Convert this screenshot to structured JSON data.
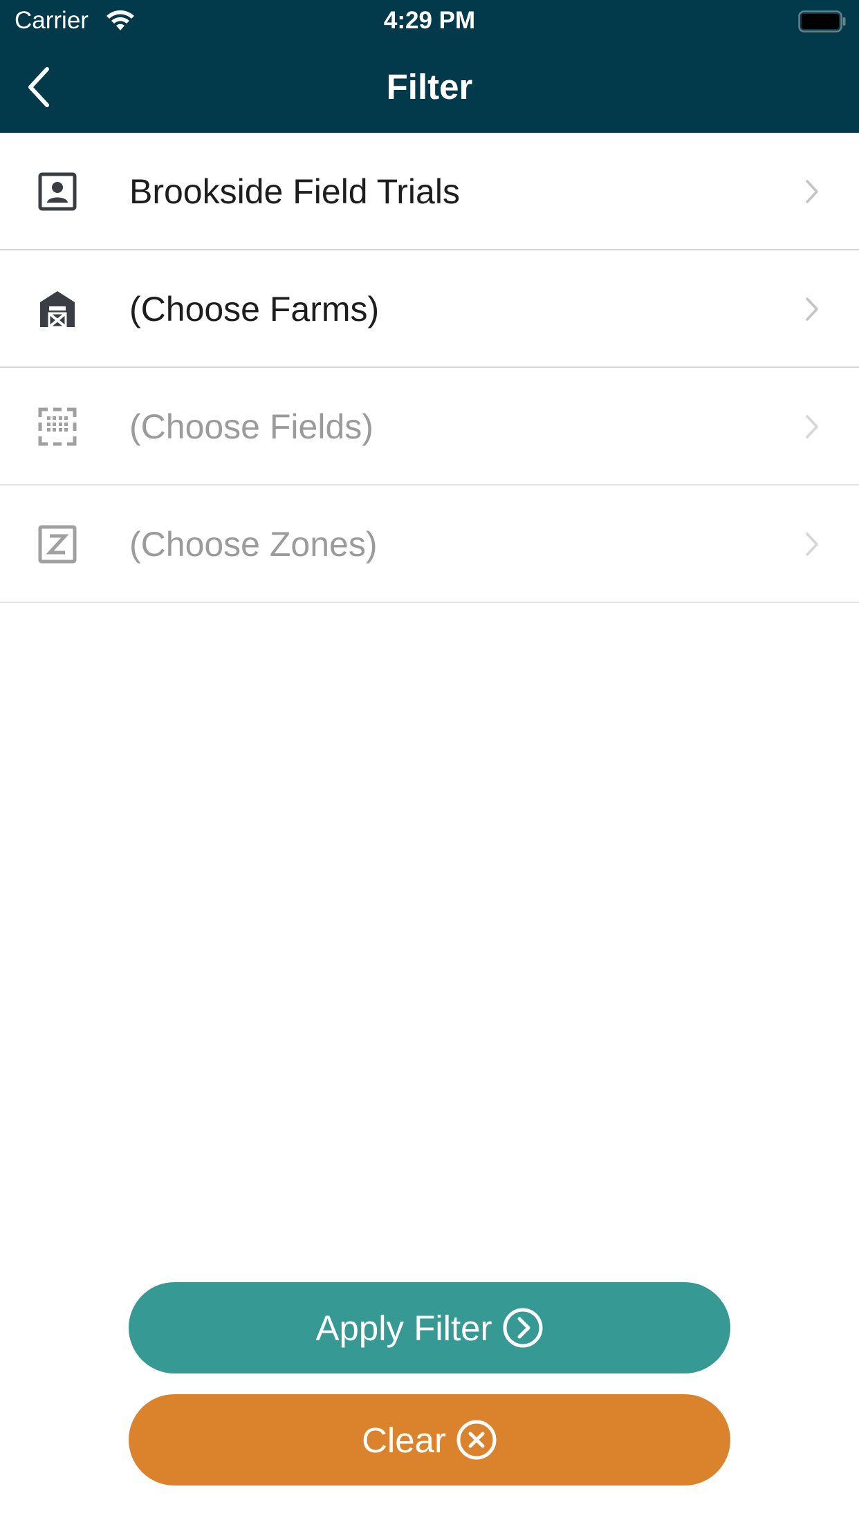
{
  "status_bar": {
    "carrier": "Carrier",
    "time": "4:29 PM",
    "icons": [
      "wifi-icon",
      "battery-icon"
    ]
  },
  "nav": {
    "title": "Filter",
    "back_icon": "chevron-left-icon"
  },
  "rows": [
    {
      "label": "Brookside Field Trials",
      "icon": "contact-card-icon",
      "enabled": true
    },
    {
      "label": "(Choose Farms)",
      "icon": "barn-icon",
      "enabled": true
    },
    {
      "label": "(Choose Fields)",
      "icon": "field-grid-icon",
      "enabled": false
    },
    {
      "label": "(Choose Zones)",
      "icon": "zone-z-icon",
      "enabled": false
    }
  ],
  "buttons": {
    "apply_label": "Apply Filter",
    "apply_icon": "arrow-circle-right-icon",
    "clear_label": "Clear",
    "clear_icon": "x-circle-icon"
  },
  "colors": {
    "header": "#023a4b",
    "apply": "#369994",
    "clear": "#db832c",
    "text_active": "#1d1d1d",
    "text_disabled": "#9b9b9b",
    "icon_active": "#3a3e44",
    "icon_disabled": "#a0a0a0"
  }
}
